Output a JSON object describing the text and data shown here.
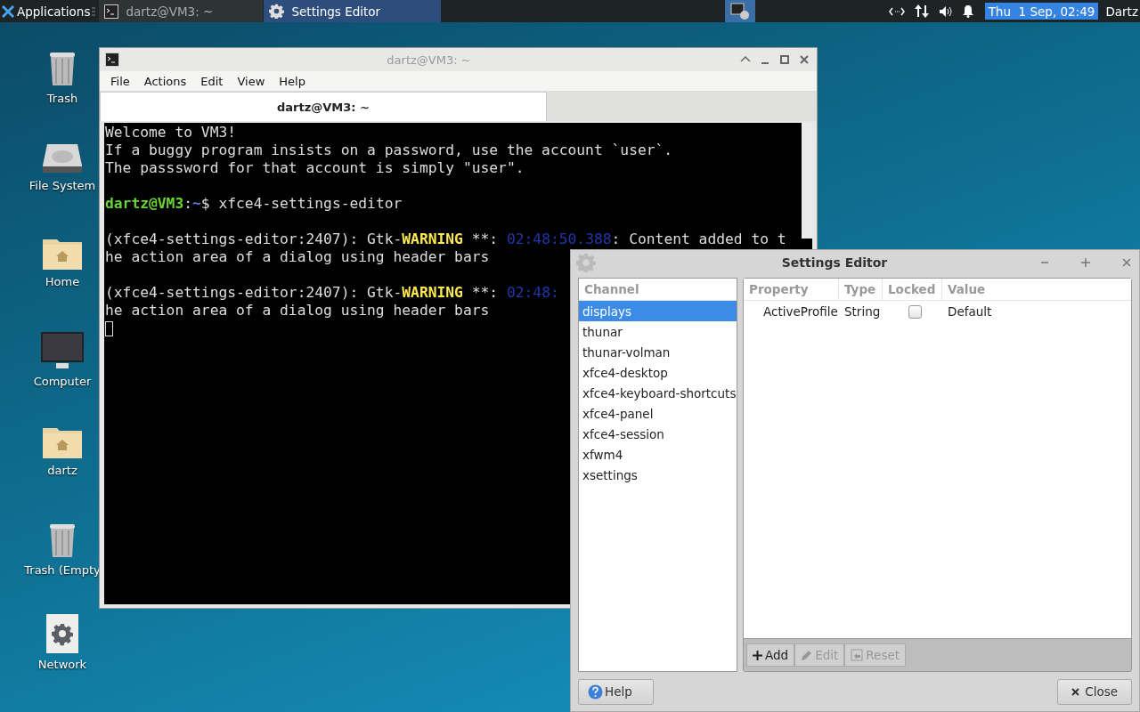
{
  "taskbar": {
    "menu_label": "Applications",
    "tasks": [
      {
        "label": "dartz@VM3: ~",
        "selected": false,
        "kind": "terminal"
      },
      {
        "label": "Settings Editor",
        "selected": true,
        "kind": "settings"
      }
    ],
    "clock": "Thu  1 Sep, 02:49",
    "user": "Dartz"
  },
  "desktop_icons": [
    {
      "label": "Trash",
      "kind": "trash"
    },
    {
      "label": "File System",
      "kind": "drive"
    },
    {
      "label": "Home",
      "kind": "folder"
    },
    {
      "label": "Computer",
      "kind": "monitor"
    },
    {
      "label": "dartz",
      "kind": "folder"
    },
    {
      "label": "Trash (Empty",
      "kind": "trash"
    },
    {
      "label": "Network",
      "kind": "network"
    }
  ],
  "terminal_window": {
    "title": "dartz@VM3: ~",
    "menu": [
      "File",
      "Actions",
      "Edit",
      "View",
      "Help"
    ],
    "tabs": [
      {
        "label": "dartz@VM3: ~",
        "selected": true
      }
    ],
    "lines": [
      {
        "kind": "text",
        "segments": [
          {
            "text": "Welcome to VM3!",
            "kind": "plain"
          }
        ]
      },
      {
        "kind": "text",
        "segments": [
          {
            "text": "If a buggy program insists on a password, use the account `user`.",
            "kind": "plain"
          }
        ]
      },
      {
        "kind": "text",
        "segments": [
          {
            "text": "The passsword for that account is simply \"user\".",
            "kind": "plain"
          }
        ]
      },
      {
        "kind": "blank"
      },
      {
        "kind": "text",
        "segments": [
          {
            "text": "dartz@VM3",
            "kind": "user"
          },
          {
            "text": ":",
            "kind": "plain"
          },
          {
            "text": "~",
            "kind": "path"
          },
          {
            "text": "$ xfce4-settings-editor",
            "kind": "plain"
          }
        ]
      },
      {
        "kind": "blank"
      },
      {
        "kind": "text",
        "segments": [
          {
            "text": "(xfce4-settings-editor:2407): Gtk-",
            "kind": "plain"
          },
          {
            "text": "WARNING",
            "kind": "warning"
          },
          {
            "text": " **: ",
            "kind": "plain"
          },
          {
            "text": "02:48:50.388",
            "kind": "timestamp"
          },
          {
            "text": ": Content added to t",
            "kind": "plain"
          }
        ]
      },
      {
        "kind": "text",
        "segments": [
          {
            "text": "he action area of a dialog using header bars",
            "kind": "plain"
          }
        ]
      },
      {
        "kind": "blank"
      },
      {
        "kind": "text",
        "segments": [
          {
            "text": "(xfce4-settings-editor:2407): Gtk-",
            "kind": "plain"
          },
          {
            "text": "WARNING",
            "kind": "warning"
          },
          {
            "text": " **: ",
            "kind": "plain"
          },
          {
            "text": "02:48:",
            "kind": "timestamp"
          }
        ]
      },
      {
        "kind": "text",
        "segments": [
          {
            "text": "he action area of a dialog using header bars",
            "kind": "plain"
          }
        ]
      },
      {
        "kind": "cursor"
      }
    ]
  },
  "settings_editor": {
    "title": "Settings Editor",
    "channel_header": "Channel",
    "channels": [
      {
        "label": "displays",
        "selected": true
      },
      {
        "label": "thunar",
        "selected": false
      },
      {
        "label": "thunar-volman",
        "selected": false
      },
      {
        "label": "xfce4-desktop",
        "selected": false
      },
      {
        "label": "xfce4-keyboard-shortcuts",
        "selected": false
      },
      {
        "label": "xfce4-panel",
        "selected": false
      },
      {
        "label": "xfce4-session",
        "selected": false
      },
      {
        "label": "xfwm4",
        "selected": false
      },
      {
        "label": "xsettings",
        "selected": false
      }
    ],
    "columns": [
      "Property",
      "Type",
      "Locked",
      "Value"
    ],
    "rows": [
      {
        "property": "ActiveProfile",
        "type": "String",
        "locked": false,
        "value": "Default"
      }
    ],
    "toolbar": [
      {
        "label": "Add",
        "kind": "add",
        "disabled": false
      },
      {
        "label": "Edit",
        "kind": "edit",
        "disabled": true
      },
      {
        "label": "Reset",
        "kind": "reset",
        "disabled": true
      }
    ],
    "help_button": "Help",
    "close_button": "Close"
  }
}
